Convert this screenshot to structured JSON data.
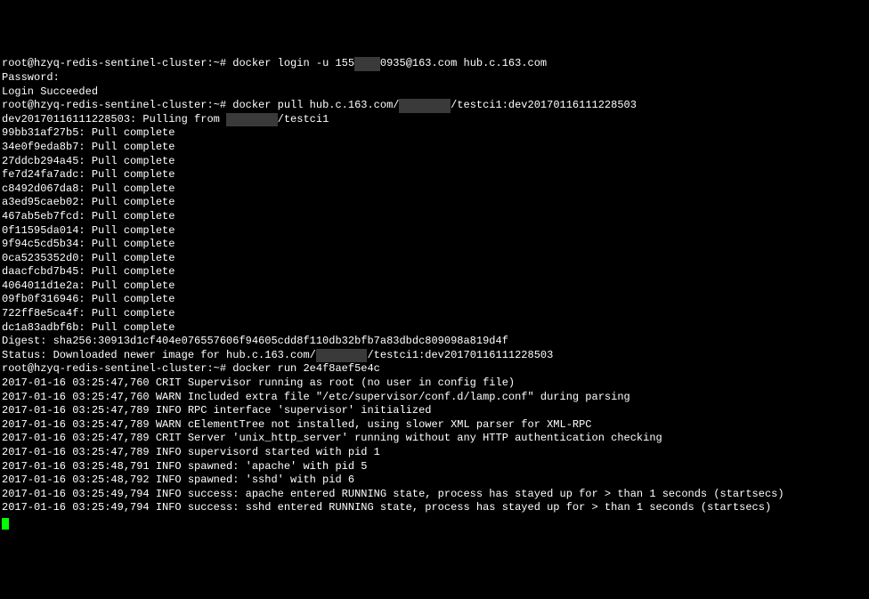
{
  "terminal": {
    "prompt": "root@hzyq-redis-sentinel-cluster:~#",
    "hostname": "hzyq-redis-sentinel-cluster",
    "user": "root",
    "lines": [
      {
        "type": "cmd",
        "prompt": "root@hzyq-redis-sentinel-cluster:~# ",
        "text_before": "docker login -u 155",
        "redacted": "    ",
        "text_after": "0935@163.com hub.c.163.com"
      },
      {
        "type": "out",
        "text": "Password:"
      },
      {
        "type": "out",
        "text": "Login Succeeded"
      },
      {
        "type": "cmd",
        "prompt": "root@hzyq-redis-sentinel-cluster:~# ",
        "text_before": "docker pull hub.c.163.com/",
        "redacted": "        ",
        "text_after": "/testci1:dev20170116111228503"
      },
      {
        "type": "out",
        "text_before": "dev20170116111228503: Pulling from ",
        "redacted": "        ",
        "text_after": "/testci1"
      },
      {
        "type": "out",
        "text": ""
      },
      {
        "type": "out",
        "text": "99bb31af27b5: Pull complete"
      },
      {
        "type": "out",
        "text": "34e0f9eda8b7: Pull complete"
      },
      {
        "type": "out",
        "text": "27ddcb294a45: Pull complete"
      },
      {
        "type": "out",
        "text": "fe7d24fa7adc: Pull complete"
      },
      {
        "type": "out",
        "text": "c8492d067da8: Pull complete"
      },
      {
        "type": "out",
        "text": "a3ed95caeb02: Pull complete"
      },
      {
        "type": "out",
        "text": "467ab5eb7fcd: Pull complete"
      },
      {
        "type": "out",
        "text": "0f11595da014: Pull complete"
      },
      {
        "type": "out",
        "text": "9f94c5cd5b34: Pull complete"
      },
      {
        "type": "out",
        "text": "0ca5235352d0: Pull complete"
      },
      {
        "type": "out",
        "text": "daacfcbd7b45: Pull complete"
      },
      {
        "type": "out",
        "text": "4064011d1e2a: Pull complete"
      },
      {
        "type": "out",
        "text": "09fb0f316946: Pull complete"
      },
      {
        "type": "out",
        "text": "722ff8e5ca4f: Pull complete"
      },
      {
        "type": "out",
        "text": "dc1a83adbf6b: Pull complete"
      },
      {
        "type": "out",
        "text": "Digest: sha256:30913d1cf404e076557606f94605cdd8f110db32bfb7a83dbdc809098a819d4f"
      },
      {
        "type": "out",
        "text_before": "Status: Downloaded newer image for hub.c.163.com/",
        "redacted": "        ",
        "text_after": "/testci1:dev20170116111228503"
      },
      {
        "type": "cmd",
        "prompt": "root@hzyq-redis-sentinel-cluster:~# ",
        "text": "docker run 2e4f8aef5e4c"
      },
      {
        "type": "out",
        "text": "2017-01-16 03:25:47,760 CRIT Supervisor running as root (no user in config file)"
      },
      {
        "type": "out",
        "text": "2017-01-16 03:25:47,760 WARN Included extra file \"/etc/supervisor/conf.d/lamp.conf\" during parsing"
      },
      {
        "type": "out",
        "text": "2017-01-16 03:25:47,789 INFO RPC interface 'supervisor' initialized"
      },
      {
        "type": "out",
        "text": "2017-01-16 03:25:47,789 WARN cElementTree not installed, using slower XML parser for XML-RPC"
      },
      {
        "type": "out",
        "text": "2017-01-16 03:25:47,789 CRIT Server 'unix_http_server' running without any HTTP authentication checking"
      },
      {
        "type": "out",
        "text": "2017-01-16 03:25:47,789 INFO supervisord started with pid 1"
      },
      {
        "type": "out",
        "text": "2017-01-16 03:25:48,791 INFO spawned: 'apache' with pid 5"
      },
      {
        "type": "out",
        "text": "2017-01-16 03:25:48,792 INFO spawned: 'sshd' with pid 6"
      },
      {
        "type": "out",
        "text": "2017-01-16 03:25:49,794 INFO success: apache entered RUNNING state, process has stayed up for > than 1 seconds (startsecs)"
      },
      {
        "type": "out",
        "text": "2017-01-16 03:25:49,794 INFO success: sshd entered RUNNING state, process has stayed up for > than 1 seconds (startsecs)"
      }
    ]
  }
}
